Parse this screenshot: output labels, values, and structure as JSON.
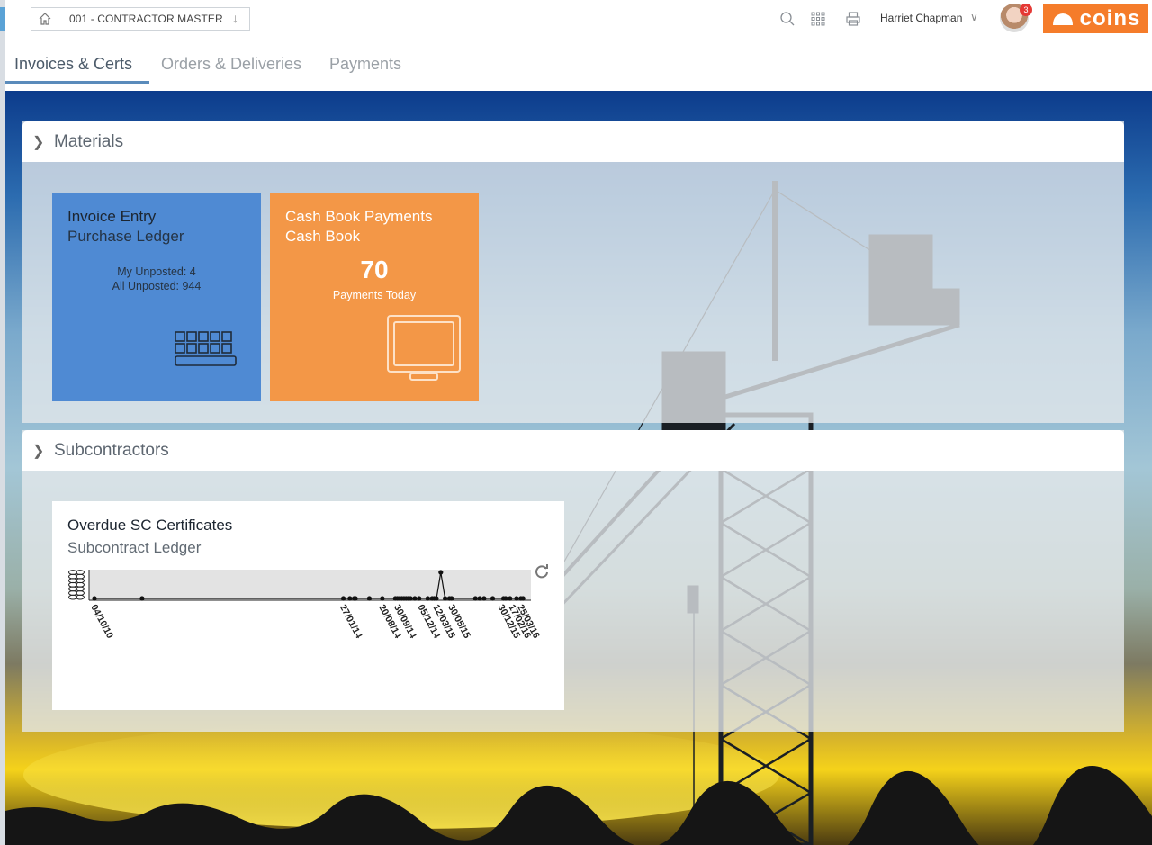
{
  "topbar": {
    "breadcrumb_label": "001 - CONTRACTOR MASTER",
    "user_name": "Harriet Chapman",
    "notification_count": "3",
    "logo_text": "coins",
    "icons": [
      "home-icon",
      "down-arrow-icon",
      "search-icon",
      "apps-grid-icon",
      "print-icon",
      "chevron-down-icon"
    ]
  },
  "tabs": [
    {
      "label": "Invoices & Certs",
      "active": true
    },
    {
      "label": "Orders & Deliveries",
      "active": false
    },
    {
      "label": "Payments",
      "active": false
    }
  ],
  "panels": {
    "materials": {
      "title": "Materials",
      "tiles": {
        "invoice": {
          "title": "Invoice Entry",
          "subtitle": "Purchase Ledger",
          "my_unposted": "My Unposted: 4",
          "all_unposted": "All Unposted: 944",
          "icon": "keyboard-icon",
          "color": "#4f8ad3"
        },
        "cash": {
          "title": "Cash Book Payments",
          "subtitle": "Cash Book",
          "value": "70",
          "caption": "Payments Today",
          "icon": "monitor-icon",
          "color": "#f39747"
        }
      }
    },
    "subcontractors": {
      "title": "Subcontractors",
      "card": {
        "title": "Overdue SC Certificates",
        "subtitle": "Subcontract Ledger",
        "icon": "refresh-icon"
      }
    }
  },
  "chart_data": {
    "type": "line",
    "title": "",
    "xlabel": "",
    "ylabel": "",
    "x_tick_labels": [
      "04/10/10",
      "27/01/14",
      "20/08/14",
      "30/09/14",
      "05/12/14",
      "12/03/15",
      "30/05/15",
      "30/12/15",
      "17/02/16",
      "25/03/16"
    ],
    "series": [
      {
        "values": [
          0,
          0,
          0,
          0,
          0,
          0,
          0,
          0,
          0,
          0,
          0,
          0,
          0,
          0,
          0,
          0,
          0,
          0,
          0,
          0,
          0,
          0,
          1,
          0,
          0,
          0,
          0,
          0,
          0,
          0,
          0,
          0,
          0,
          0,
          0,
          0
        ]
      }
    ],
    "grid": false,
    "legend": "none"
  }
}
